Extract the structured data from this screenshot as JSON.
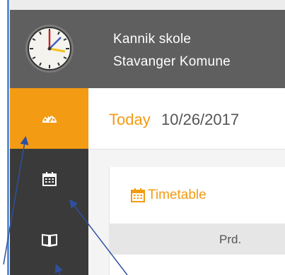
{
  "header": {
    "school_name": "Kannik skole",
    "municipality": "Stavanger Komune"
  },
  "sidebar": {
    "items": [
      {
        "icon": "dashboard-icon",
        "active": true
      },
      {
        "icon": "calendar-icon",
        "active": false
      },
      {
        "icon": "book-icon",
        "active": false
      }
    ]
  },
  "today": {
    "label": "Today",
    "date": "10/26/2017"
  },
  "timetable": {
    "title": "Timetable",
    "columns": [
      "Prd."
    ]
  },
  "colors": {
    "accent": "#f29b13",
    "header_bg": "#5f5f5f",
    "sidebar_bg": "#3a3a3a",
    "annotation_arrow": "#2f4f9f"
  }
}
